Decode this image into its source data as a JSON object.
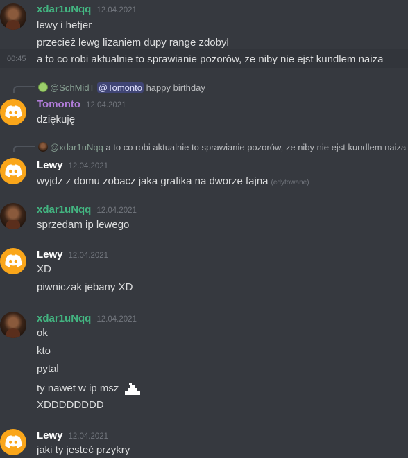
{
  "colors": {
    "green_user": "#43b581",
    "purple_user": "#b07cd8",
    "white_user": "#ffffff",
    "discord_orange": "#faa61a"
  },
  "messages": [
    {
      "author": "xdar1uNqq",
      "time": "12.04.2021",
      "lines": [
        "lewy i hetjer",
        "przecież lewg lizaniem dupy range zdobyl",
        "a to co robi aktualnie to sprawianie pozorów, ze niby nie ejst kundlem naiza"
      ],
      "hover_time": "00:45"
    },
    {
      "reply_author": "@SchMidT",
      "reply_mention": "@Tomonto",
      "reply_text": "happy birthday",
      "author": "Tomonto",
      "time": "12.04.2021",
      "lines": [
        "dziękuję"
      ]
    },
    {
      "reply_author": "@xdar1uNqq",
      "reply_text": "a to co robi aktualnie to sprawianie pozorów, ze niby nie ejst kundlem naiza",
      "author": "Lewy",
      "time": "12.04.2021",
      "lines": [
        "wyjdz z domu zobacz jaka grafika na dworze fajna"
      ],
      "edited": "(edytowane)"
    },
    {
      "author": "xdar1uNqq",
      "time": "12.04.2021",
      "lines": [
        "sprzedam ip lewego"
      ]
    },
    {
      "author": "Lewy",
      "time": "12.04.2021",
      "lines": [
        "XD",
        "piwniczak jebany XD"
      ]
    },
    {
      "author": "xdar1uNqq",
      "time": "12.04.2021",
      "lines": [
        "ok",
        "kto",
        "pytal",
        "ty nawet w ip msz",
        "XDDDDDDDD"
      ]
    },
    {
      "author": "Lewy",
      "time": "12.04.2021",
      "lines": [
        "jaki ty jesteć przykry"
      ]
    }
  ]
}
